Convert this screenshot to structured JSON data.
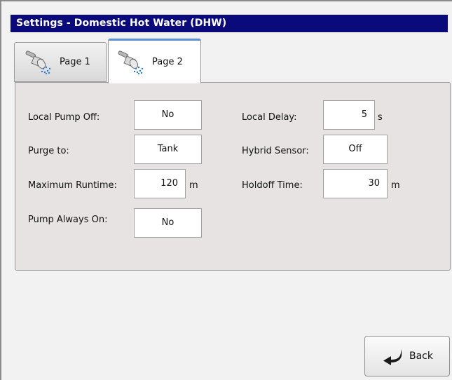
{
  "window": {
    "title": "Settings - Domestic Hot Water (DHW)"
  },
  "tabs": [
    {
      "label": "Page 1",
      "icon": "shower-head-icon",
      "active": false
    },
    {
      "label": "Page 2",
      "icon": "shower-head-icon",
      "active": true
    }
  ],
  "left_fields": [
    {
      "label": "Local Pump Off:",
      "value": "No",
      "unit": ""
    },
    {
      "label": "Purge to:",
      "value": "Tank",
      "unit": ""
    },
    {
      "label": "Maximum Runtime:",
      "value": "120",
      "unit": "m"
    },
    {
      "label": "Pump Always On:",
      "value": "No",
      "unit": ""
    }
  ],
  "right_fields": [
    {
      "label": "Local Delay:",
      "value": "5",
      "unit": "s"
    },
    {
      "label": "Hybrid Sensor:",
      "value": "Off",
      "unit": ""
    },
    {
      "label": "Holdoff Time:",
      "value": "30",
      "unit": "m"
    }
  ],
  "footer": {
    "back_label": "Back",
    "back_icon": "return-arrow-icon"
  },
  "colors": {
    "titlebar": "#0a0a7a",
    "panel": "#e7e3e3",
    "active_tab_accent": "#5b8fd6"
  }
}
